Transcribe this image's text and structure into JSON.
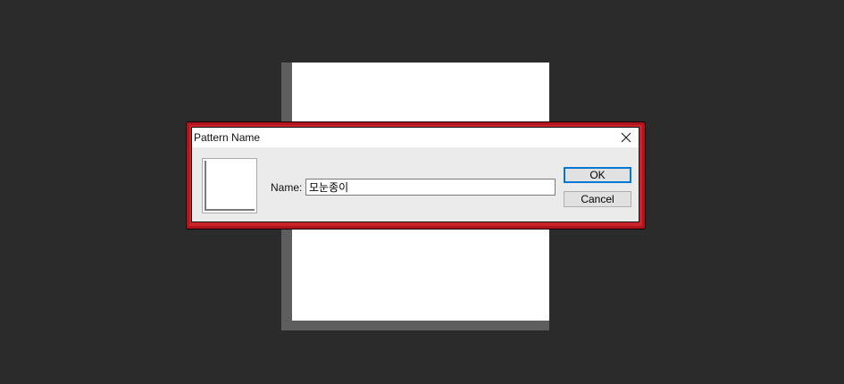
{
  "dialog": {
    "title": "Pattern Name",
    "name_label": "Name:",
    "name_value": "모눈종이",
    "ok_label": "OK",
    "cancel_label": "Cancel"
  },
  "colors": {
    "workspace_background": "#2b2b2b",
    "highlight_border": "#c8242a",
    "ok_focus_border": "#0078d7"
  },
  "icons": {
    "close": "close-icon"
  }
}
